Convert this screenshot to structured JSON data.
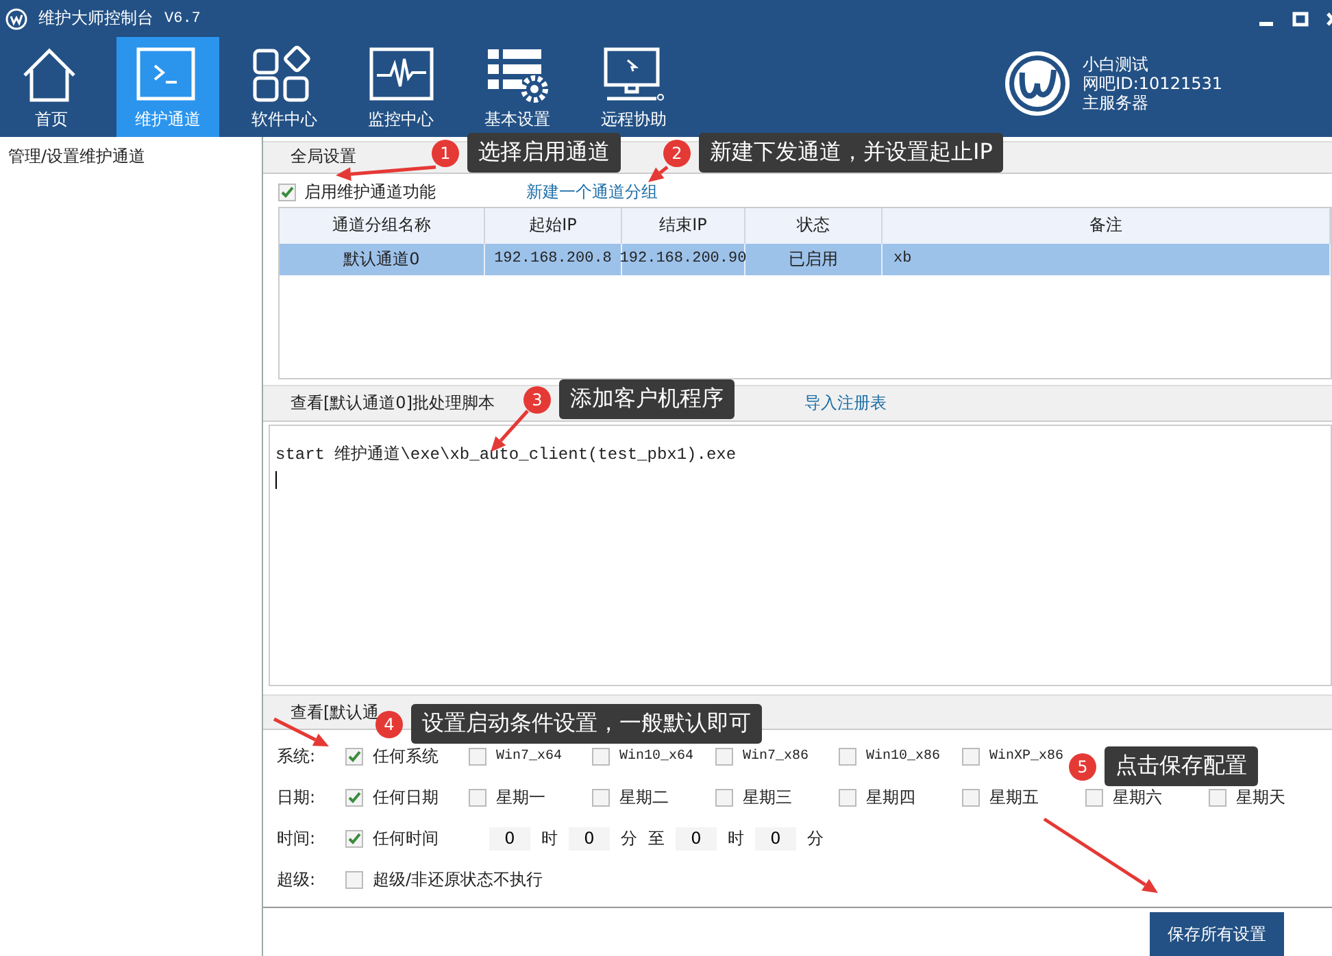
{
  "window": {
    "title": "维护大师控制台",
    "version": "V6.7"
  },
  "toolbar": [
    {
      "label": "首页",
      "kind": "home",
      "selected": false
    },
    {
      "label": "维护通道",
      "kind": "terminal",
      "selected": true
    },
    {
      "label": "软件中心",
      "kind": "apps",
      "selected": false
    },
    {
      "label": "监控中心",
      "kind": "monitor",
      "selected": false
    },
    {
      "label": "基本设置",
      "kind": "settings",
      "selected": false
    },
    {
      "label": "远程协助",
      "kind": "remote",
      "selected": false
    }
  ],
  "account": {
    "name": "小白测试",
    "id": "网吧ID:10121531",
    "role": "主服务器"
  },
  "sidebar": {
    "items": [
      {
        "label": "管理/设置维护通道",
        "selected": false
      }
    ]
  },
  "global": {
    "title": "全局设置",
    "enable": {
      "label": "启用维护通道功能",
      "checked": true
    },
    "new_group_link": "新建一个通道分组",
    "table": {
      "columns": [
        "通道分组名称",
        "起始IP",
        "结束IP",
        "状态",
        "备注"
      ],
      "rows": [
        {
          "cells": [
            "默认通道0",
            "192.168.200.8",
            "192.168.200.90",
            "已启用",
            "xb"
          ],
          "selected": true
        }
      ]
    }
  },
  "script": {
    "title": "查看[默认通道0]批处理脚本",
    "link": "导入注册表",
    "text": "start 维护通道\\exe\\xb_auto_client(test_pbx1).exe"
  },
  "conditions": {
    "title": "查看[默认通",
    "rows": [
      {
        "kind": "checks",
        "label": "系统:",
        "options": [
          {
            "label": "任何系统",
            "checked": true
          },
          {
            "label": "Win7_x64",
            "checked": false
          },
          {
            "label": "Win10_x64",
            "checked": false
          },
          {
            "label": "Win7_x86",
            "checked": false
          },
          {
            "label": "Win10_x86",
            "checked": false
          },
          {
            "label": "WinXP_x86",
            "checked": false
          }
        ]
      },
      {
        "kind": "checks",
        "label": "日期:",
        "options": [
          {
            "label": "任何日期",
            "checked": true
          },
          {
            "label": "星期一",
            "checked": false
          },
          {
            "label": "星期二",
            "checked": false
          },
          {
            "label": "星期三",
            "checked": false
          },
          {
            "label": "星期四",
            "checked": false
          },
          {
            "label": "星期五",
            "checked": false
          },
          {
            "label": "星期六",
            "checked": false
          },
          {
            "label": "星期天",
            "checked": false
          }
        ]
      },
      {
        "kind": "time",
        "label": "时间:",
        "option": {
          "label": "任何时间",
          "checked": true
        },
        "parts": [
          {
            "kind": "field",
            "value": "0"
          },
          {
            "kind": "unit",
            "text": "时"
          },
          {
            "kind": "field",
            "value": "0"
          },
          {
            "kind": "unit",
            "text": "分"
          },
          {
            "kind": "unit",
            "text": "至"
          },
          {
            "kind": "field",
            "value": "0"
          },
          {
            "kind": "unit",
            "text": "时"
          },
          {
            "kind": "field",
            "value": "0"
          },
          {
            "kind": "unit",
            "text": "分"
          }
        ]
      },
      {
        "kind": "checks",
        "label": "超级:",
        "options": [
          {
            "label": "超级/非还原状态不执行",
            "checked": false
          }
        ]
      }
    ]
  },
  "save_button": "保存所有设置",
  "callouts": [
    {
      "number": "1",
      "text": "选择启用通道"
    },
    {
      "number": "2",
      "text": "新建下发通道，并设置起止IP"
    },
    {
      "number": "3",
      "text": "添加客户机程序"
    },
    {
      "number": "4",
      "text": "设置启动条件设置，一般默认即可"
    },
    {
      "number": "5",
      "text": "点击保存配置"
    }
  ]
}
